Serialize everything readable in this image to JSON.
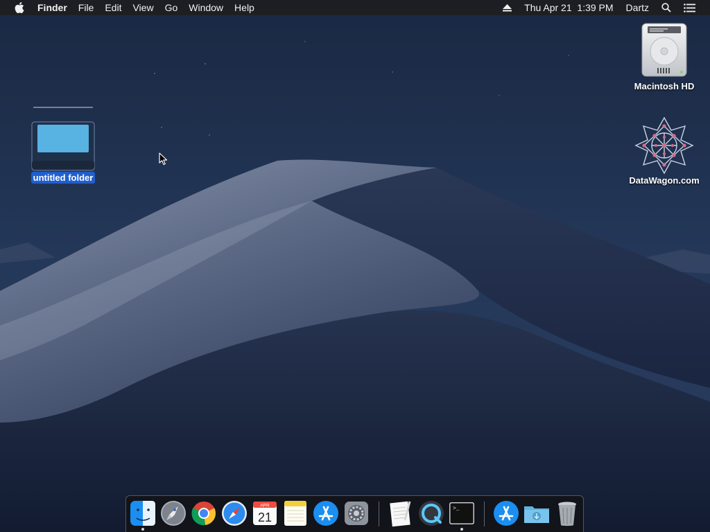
{
  "menubar": {
    "apple_icon": "apple-logo-icon",
    "app_name": "Finder",
    "menus": [
      "File",
      "Edit",
      "View",
      "Go",
      "Window",
      "Help"
    ],
    "status": {
      "eject_icon": "eject-icon",
      "datetime": "Thu Apr 21  1:39 PM",
      "user": "Dartz",
      "spotlight_icon": "search-icon",
      "notification_icon": "notification-center-icon"
    }
  },
  "desktop": {
    "icons": [
      {
        "label": "untitled folder",
        "kind": "folder",
        "selected": true
      },
      {
        "label": "Macintosh HD",
        "kind": "hard-drive",
        "selected": false
      },
      {
        "label": "DataWagon.com",
        "kind": "network-share",
        "selected": false
      }
    ]
  },
  "dock": {
    "apps": [
      {
        "name": "Finder",
        "icon": "finder-icon",
        "running": true
      },
      {
        "name": "Launchpad",
        "icon": "launchpad-icon",
        "running": false
      },
      {
        "name": "Google Chrome",
        "icon": "chrome-icon",
        "running": false
      },
      {
        "name": "Safari",
        "icon": "safari-icon",
        "running": false
      },
      {
        "name": "Calendar",
        "icon": "calendar-icon",
        "running": false,
        "month": "APR",
        "day": "21"
      },
      {
        "name": "Notes",
        "icon": "notes-icon",
        "running": false
      },
      {
        "name": "App Store",
        "icon": "app-store-icon",
        "running": false
      },
      {
        "name": "System Preferences",
        "icon": "system-preferences-icon",
        "running": false
      },
      {
        "name": "TextEdit",
        "icon": "textedit-icon",
        "running": false
      },
      {
        "name": "QuickTime Player",
        "icon": "quicktime-icon",
        "running": false
      },
      {
        "name": "Terminal",
        "icon": "terminal-icon",
        "running": true,
        "prompt": ">_"
      }
    ],
    "others": [
      {
        "name": "Applications",
        "icon": "applications-folder-icon"
      },
      {
        "name": "Downloads",
        "icon": "downloads-folder-icon"
      },
      {
        "name": "Trash",
        "icon": "trash-icon"
      }
    ]
  },
  "colors": {
    "selection": "#1f5fcf",
    "menubar_bg": "#1e1e21",
    "sky": "#1b2942"
  }
}
